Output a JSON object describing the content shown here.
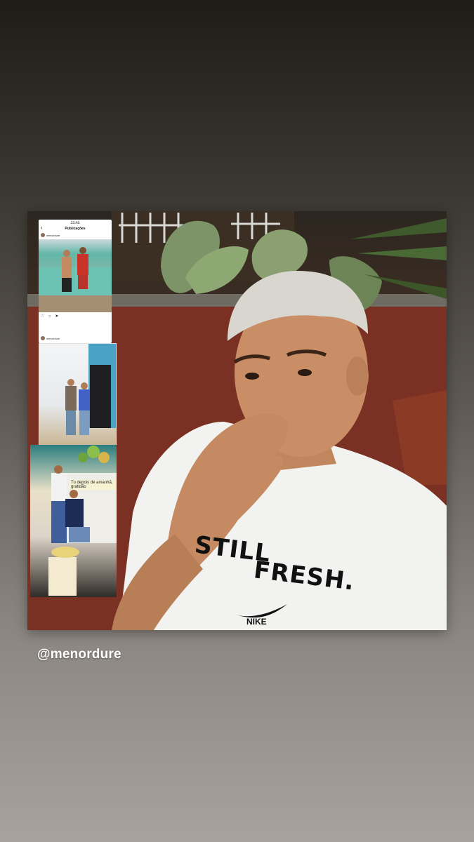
{
  "story": {
    "caption": "@menordure"
  },
  "photo": {
    "shirt_line1": "STILL",
    "shirt_line2": "FRESH.",
    "shirt_brand": "NIKE"
  },
  "screenshot_post": {
    "status_time": "22:46",
    "profile_small": "menordure",
    "title": "Publicações",
    "username": "menordure",
    "footer_user": "menordure"
  },
  "party_photo": {
    "banner_text": "Tu depois de amanhã, gratidão"
  }
}
